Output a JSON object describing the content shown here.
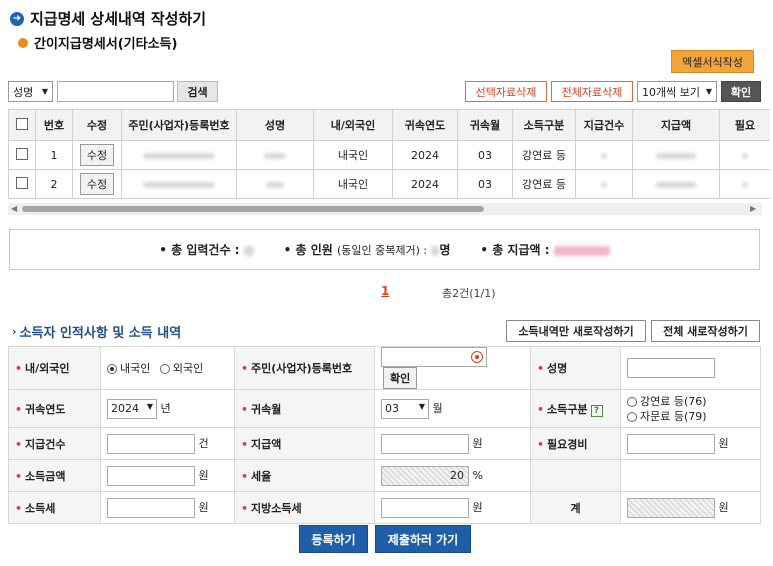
{
  "page": {
    "title": "지급명세 상세내역 작성하기",
    "subtitle": "간이지급명세서(기타소득)"
  },
  "toolbar": {
    "excel_button": "엑셀서식작성",
    "search_field_select": "성명",
    "search_button": "검색",
    "delete_selected": "선택자료삭제",
    "delete_all": "전체자료삭제",
    "page_size_select": "10개씩 보기",
    "confirm_button": "확인"
  },
  "table": {
    "columns": [
      "번호",
      "수정",
      "주민(사업자)등록번호",
      "성명",
      "내/외국인",
      "귀속연도",
      "귀속월",
      "소득구분",
      "지급건수",
      "지급액",
      "필요"
    ],
    "edit_label": "수정",
    "rows": [
      {
        "no": "1",
        "nationality": "내국인",
        "year": "2024",
        "month": "03",
        "income_type": "강연료 등"
      },
      {
        "no": "2",
        "nationality": "내국인",
        "year": "2024",
        "month": "03",
        "income_type": "강연료 등"
      }
    ]
  },
  "summary": {
    "total_count_label": "• 총 입력건수 :",
    "total_persons_label": "• 총 인원",
    "total_persons_sub": "(동일인 중복제거) :",
    "total_persons_suffix": "명",
    "total_amount_label": "• 총 지급액 :"
  },
  "pagination": {
    "current": "1",
    "info": "총2건(1/1)"
  },
  "form": {
    "section_title": "소득자 인적사항 및 소득 내역",
    "new_income_button": "소득내역만 새로작성하기",
    "new_all_button": "전체 새로작성하기",
    "labels": {
      "nationality": "내/외국인",
      "reg_no": "주민(사업자)등록번호",
      "name": "성명",
      "year": "귀속연도",
      "month": "귀속월",
      "income_type": "소득구분",
      "pay_count": "지급건수",
      "pay_amount": "지급액",
      "expense": "필요경비",
      "income_amount": "소득금액",
      "tax_rate": "세율",
      "income_tax": "소득세",
      "local_tax": "지방소득세",
      "total": "계"
    },
    "nationality_options": [
      "내국인",
      "외국인"
    ],
    "confirm_button": "확인",
    "year_value": "2024",
    "year_unit": "년",
    "month_value": "03",
    "month_unit": "월",
    "income_type_options": [
      "강연료 등(76)",
      "자문료 등(79)"
    ],
    "unit_count": "건",
    "unit_won": "원",
    "tax_rate_value": "20",
    "unit_percent": "%"
  },
  "actions": {
    "register": "등록하기",
    "submit": "제출하러 가기"
  }
}
